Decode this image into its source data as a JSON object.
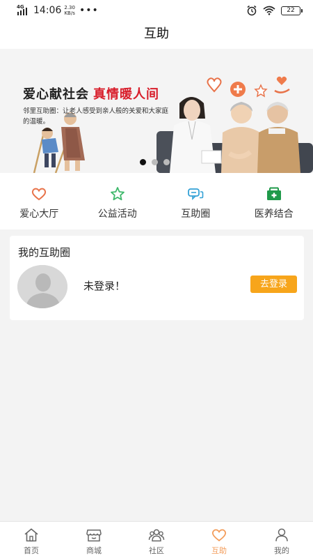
{
  "status_bar": {
    "network": "4G",
    "time": "14:06",
    "speed_value": "2.30",
    "speed_unit": "KB/s",
    "dots": "•••",
    "battery": "22",
    "icons": [
      "alarm-icon",
      "wifi-icon",
      "battery-icon"
    ]
  },
  "header": {
    "title": "互助"
  },
  "banner": {
    "title_black": "爱心献社会",
    "title_red": "真情暖人间",
    "description": "邻里互助圈：让老人感受到亲人般的关爱和大家庭的温暖。",
    "slide_count": 3,
    "active_slide": 0
  },
  "categories": [
    {
      "label": "爱心大厅",
      "icon": "heart-icon"
    },
    {
      "label": "公益活动",
      "icon": "star-icon"
    },
    {
      "label": "互助圈",
      "icon": "chat-bubbles-icon"
    },
    {
      "label": "医养结合",
      "icon": "medical-house-icon"
    }
  ],
  "circle_card": {
    "title": "我的互助圈",
    "status": "未登录！",
    "login_label": "去登录",
    "avatar_icon": "avatar-placeholder-icon"
  },
  "tabbar": [
    {
      "label": "首页",
      "icon": "home-icon"
    },
    {
      "label": "商城",
      "icon": "shop-icon"
    },
    {
      "label": "社区",
      "icon": "community-icon"
    },
    {
      "label": "互助",
      "icon": "heart-tab-icon",
      "active": true
    },
    {
      "label": "我的",
      "icon": "person-icon"
    }
  ],
  "colors": {
    "accent": "#f39c5a",
    "banner_red": "#d81e2b",
    "login_button": "#f7a51b",
    "category_heart": "#e8734a",
    "category_star": "#3eb86b",
    "category_chat": "#33a1d6",
    "category_medical": "#1f9a4a"
  }
}
